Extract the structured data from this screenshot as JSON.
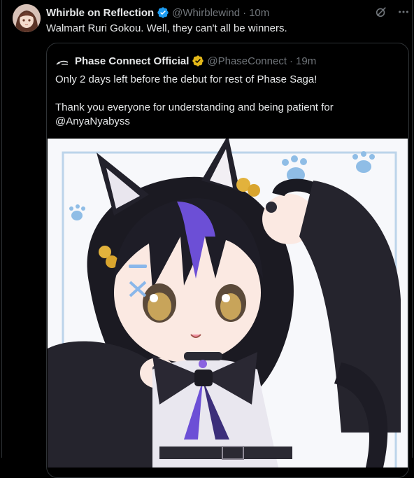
{
  "tweet": {
    "display_name": "Whirble on Reflection",
    "handle": "@Whirblewind",
    "separator": "·",
    "time": "10m",
    "text": "Walmart Ruri Gokou. Well, they can't all be winners."
  },
  "quote": {
    "display_name": "Phase Connect Official",
    "handle": "@PhaseConnect",
    "separator": "·",
    "time": "19m",
    "line1": "Only 2 days left before the debut for rest of Phase Saga!",
    "line2": "Thank you everyone for understanding and being patient for",
    "mention": "@AnyaNyabyss"
  },
  "icons": {
    "verified_blue": "verified-badge-icon",
    "verified_gold": "gold-verified-badge-icon",
    "grok": "grok-icon",
    "more": "more-options-icon"
  },
  "colors": {
    "background": "#000000",
    "text": "#e7e9ea",
    "muted": "#71767b",
    "border": "#2f3336",
    "verified_blue": "#1d9bf0",
    "verified_gold": "#e2b719",
    "hair_purple": "#6c4fd6"
  }
}
